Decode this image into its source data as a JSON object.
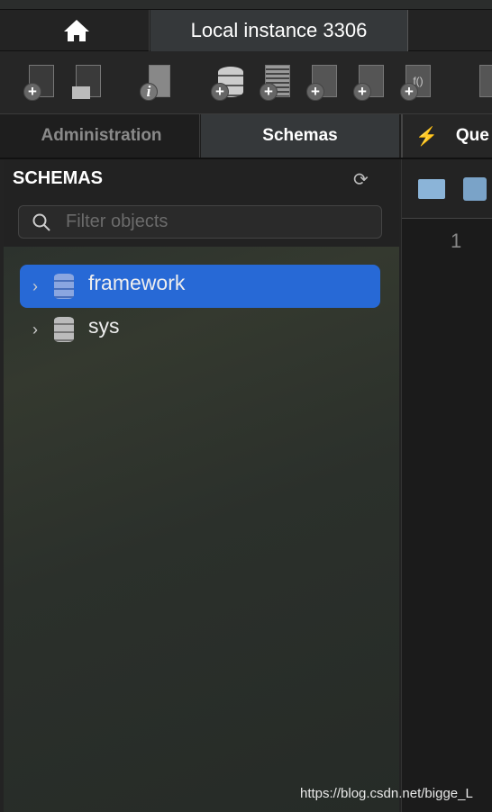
{
  "tabs": {
    "instance": "Local instance 3306"
  },
  "subtabs": {
    "administration": "Administration",
    "schemas": "Schemas",
    "query": "Que"
  },
  "schemas": {
    "title": "SCHEMAS",
    "filter_placeholder": "Filter objects",
    "items": [
      {
        "label": "framework",
        "selected": true
      },
      {
        "label": "sys",
        "selected": false
      }
    ]
  },
  "editor": {
    "line_number": "1"
  },
  "watermark": "https://blog.csdn.net/bigge_L",
  "colors": {
    "selection": "#2769d6"
  }
}
